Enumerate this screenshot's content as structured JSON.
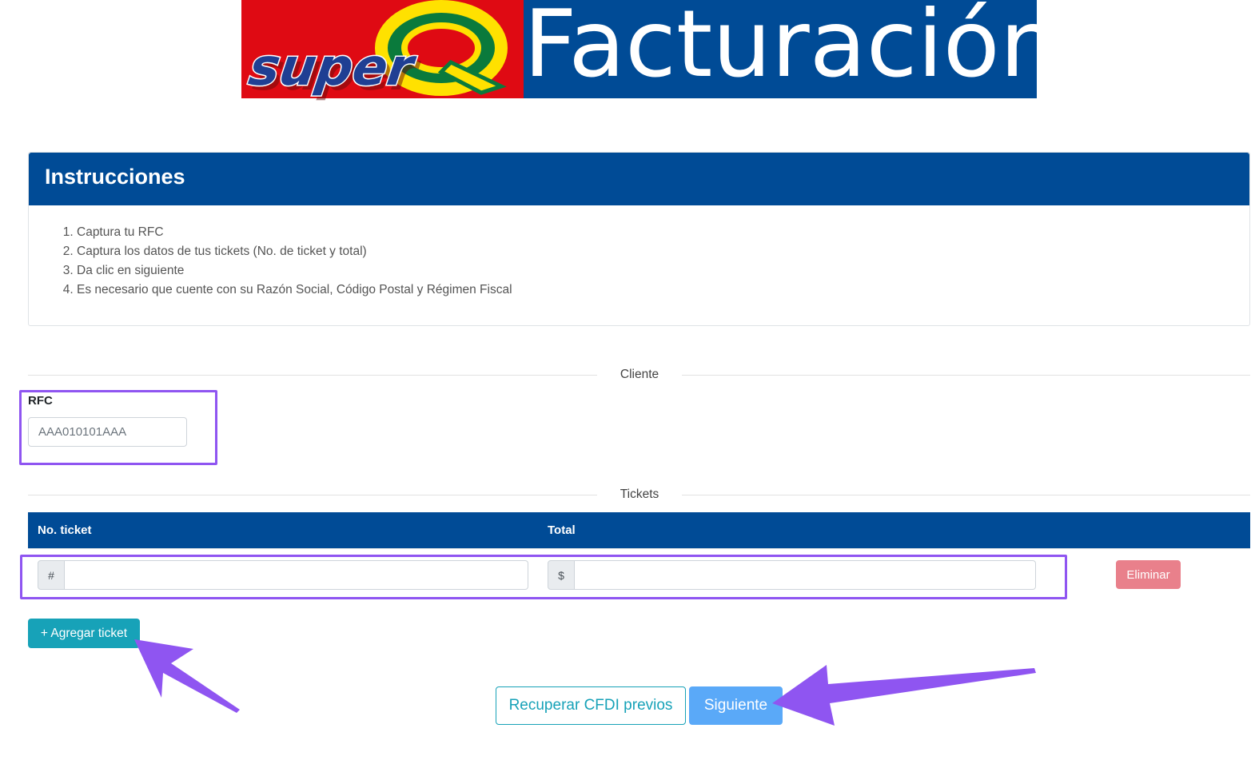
{
  "brand": {
    "logo_text": "superQ",
    "title": "Facturación",
    "colors": {
      "red": "#df0a13",
      "blue": "#004b96",
      "yellow": "#ffe100",
      "green": "#0a7a3c"
    }
  },
  "instructions": {
    "heading": "Instrucciones",
    "steps": [
      "Captura tu RFC",
      "Captura los datos de tus tickets (No. de ticket y total)",
      "Da clic en siguiente",
      "Es necesario que cuente con su Razón Social, Código Postal y Régimen Fiscal"
    ]
  },
  "cliente": {
    "section_label": "Cliente",
    "rfc_label": "RFC",
    "rfc_placeholder": "AAA010101AAA"
  },
  "tickets": {
    "section_label": "Tickets",
    "columns": [
      "No. ticket",
      "Total"
    ],
    "ticket_addon": "#",
    "total_addon": "$",
    "delete_label": "Eliminar",
    "add_label": "+ Agregar ticket"
  },
  "actions": {
    "recover_label": "Recuperar CFDI previos",
    "next_label": "Siguiente"
  },
  "annotations": {
    "highlight_color": "#8f55f1"
  }
}
